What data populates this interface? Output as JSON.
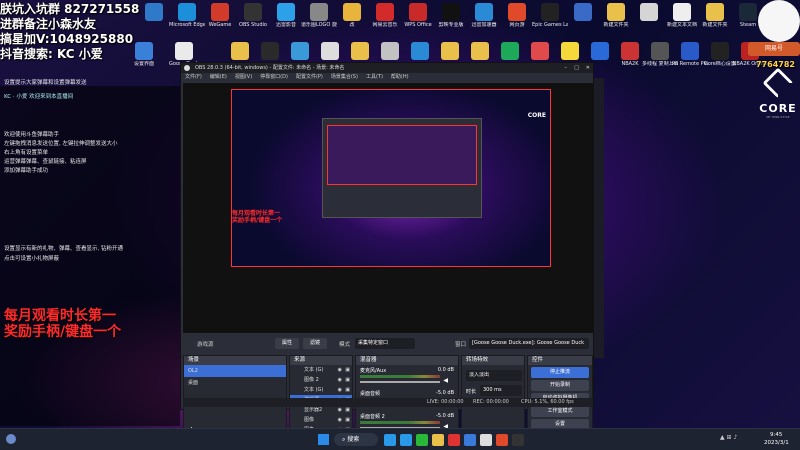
{
  "overlay": {
    "line1": "朕坑入坑群 827271558",
    "line2": "进群备注小森水友",
    "line3": "搞星加V:1048925880",
    "line4": "抖音搜索: KC 小爱"
  },
  "desktop_icons": [
    {
      "label": "",
      "color": "#2f79c9"
    },
    {
      "label": "Microsoft Edge",
      "color": "#1b8fd9"
    },
    {
      "label": "WeGame",
      "color": "#d23a2a"
    },
    {
      "label": "OBS Studio",
      "color": "#333"
    },
    {
      "label": "迅雷影音",
      "color": "#2ca0e8"
    },
    {
      "label": "道乐图LOGO 旋转2023",
      "color": "#888"
    },
    {
      "label": "改",
      "color": "#e8b53a"
    },
    {
      "label": "网易云音乐",
      "color": "#d32a2a"
    },
    {
      "label": "WPS Office",
      "color": "#c82a2a"
    },
    {
      "label": "剪映专业版",
      "color": "#111"
    },
    {
      "label": "迅雷加速器",
      "color": "#2a8ad6"
    },
    {
      "label": "网页游",
      "color": "#e04a2a"
    },
    {
      "label": "Epic Games Launcher",
      "color": "#222"
    },
    {
      "label": "",
      "color": "#3a6ac8"
    },
    {
      "label": "新建文件夹",
      "color": "#e8c04a"
    },
    {
      "label": "",
      "color": "#d5d5d5"
    },
    {
      "label": "新建文本文档",
      "color": "#eee"
    },
    {
      "label": "新建文件夹",
      "color": "#e8c04a"
    },
    {
      "label": "Steam",
      "color": "#1b2838"
    }
  ],
  "row2_icons": [
    {
      "label": "设置界面",
      "color": "#3a7fd8"
    },
    {
      "label": "Goose Duck",
      "color": "#eaeaea"
    },
    {
      "label": "",
      "color": "#e8c04a"
    },
    {
      "label": "",
      "color": "#2a2a2a"
    },
    {
      "label": "",
      "color": "#3a9ad8"
    },
    {
      "label": "",
      "color": "#ddd"
    },
    {
      "label": "",
      "color": "#e8c04a"
    },
    {
      "label": "",
      "color": "#c2c2c2"
    },
    {
      "label": "",
      "color": "#2a8ad6"
    },
    {
      "label": "",
      "color": "#e8c04a"
    },
    {
      "label": "",
      "color": "#e8c04a"
    },
    {
      "label": "",
      "color": "#1ea85a"
    },
    {
      "label": "",
      "color": "#e04a4a"
    },
    {
      "label": "",
      "color": "#f5d83a"
    },
    {
      "label": "",
      "color": "#2a6ad8"
    },
    {
      "label": "NBA2K",
      "color": "#c33"
    },
    {
      "label": "多线程 复制.bat",
      "color": "#555"
    },
    {
      "label": "PS Remote Play",
      "color": "#2a5ac8"
    },
    {
      "label": "Core档心设置",
      "color": "#222"
    },
    {
      "label": "NBA2K Online",
      "color": "#b22"
    }
  ],
  "danmu_header": "设置提示大家弹幕和设置弹幕发送",
  "danmu_user": "KC · 小爱 欢迎来到本直播间",
  "danmu_lines": [
    "欢迎使用斗鱼弹幕助手",
    "左键拖拽消息发送位置, 左键拉伸调整发送大小",
    "右上角有设置菜单",
    "运营弹幕弹幕、查鼠链接、粘连屏",
    "添加弹幕助手成功"
  ],
  "danmu_lines2": [
    "设置显示有新的礼物、弹幕、查看显示, 钻粉开通",
    "点击可设置小礼物屏蔽"
  ],
  "red_text": "每月观看时长第一\n奖励手柄/键盘一个",
  "obs": {
    "title": "OBS 28.0.3 (64-bit, windows) - 配置文件: 未命名 - 场景: 未命名",
    "menu": [
      "文件(F)",
      "编辑(E)",
      "视图(V)",
      "停靠窗口(D)",
      "配置文件(P)",
      "场景集合(S)",
      "工具(T)",
      "帮助(H)"
    ],
    "source_name": "游戏源",
    "props_btn": "属性",
    "filter_btn": "滤镜",
    "mode_label": "模式",
    "mode_value": "采集特定窗口",
    "window_label": "窗口",
    "window_value": "[Goose Goose Duck.exe]: Goose Goose Duck",
    "scenes_title": "场景",
    "scenes": [
      "OL2",
      "桌面"
    ],
    "sources_title": "来源",
    "sources": [
      "文本 (G)",
      "图像 2",
      "文本 (G)",
      "游戏源",
      "显示器2",
      "图像",
      "图像"
    ],
    "mixer_title": "混音器",
    "mixer": [
      {
        "name": "麦克风/Aux",
        "db": "0.0 dB"
      },
      {
        "name": "桌面音频",
        "db": "-5.0 dB"
      },
      {
        "name": "桌面音频 2",
        "db": "-5.0 dB"
      }
    ],
    "transition_title": "转场特效",
    "transition_value": "淡入淡出",
    "duration_label": "时长",
    "duration_value": "300 ms",
    "controls_title": "控件",
    "controls": [
      "停止推流",
      "开始录制",
      "启动虚拟摄像机",
      "工作室模式",
      "设置",
      "退出"
    ],
    "status_live": "LIVE: 00:00:00",
    "status_rec": "REC: 00:00:00",
    "status_cpu": "CPU: 5.1%, 60.00 fps"
  },
  "brand": {
    "name": "CORE",
    "tag": "MY OWN STYLE"
  },
  "top_right": {
    "badge": "网易号",
    "number": "7764782"
  },
  "taskbar": {
    "search": "搜索",
    "time": "9:45",
    "date": "2023/3/1",
    "items": [
      "#2a9ae8",
      "#2a9ae8",
      "#2ab83a",
      "#e8c04a",
      "#d33",
      "#3a7ad8",
      "#ddd",
      "#e04a2a",
      "#333"
    ]
  },
  "colors": {
    "accent": "#3b6fd6",
    "rec": "#ff2a2a"
  }
}
